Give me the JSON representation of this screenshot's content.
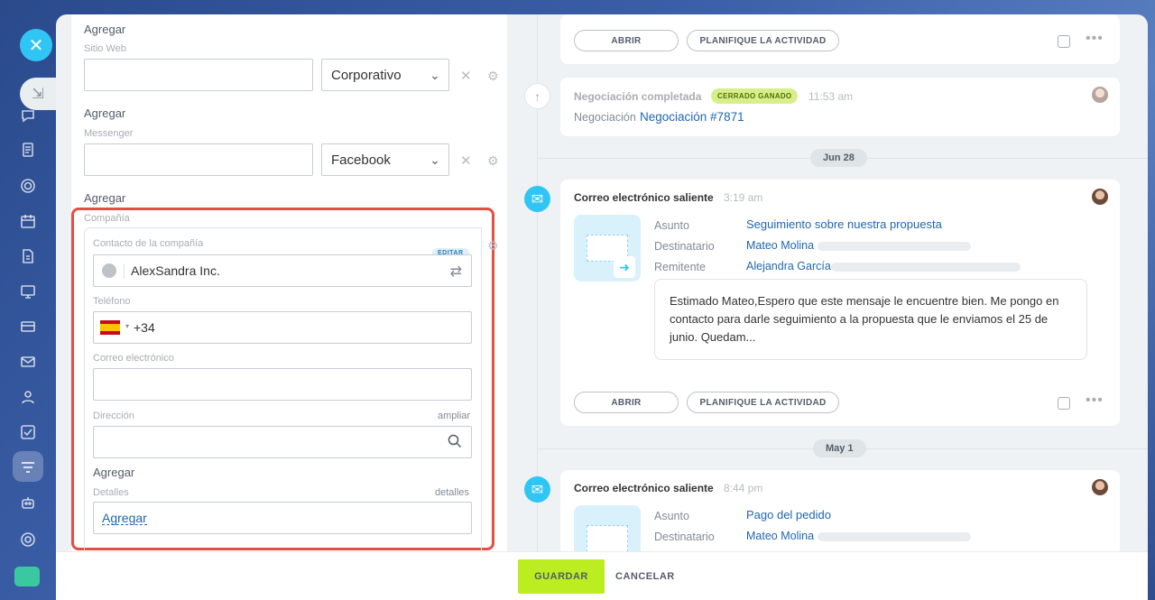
{
  "form": {
    "website": {
      "add_label": "Agregar",
      "label": "Sitio Web",
      "type_value": "Corporativo"
    },
    "messenger": {
      "add_label": "Agregar",
      "label": "Messenger",
      "type_value": "Facebook"
    },
    "add_label_3": "Agregar",
    "company": {
      "section_label": "Compañía",
      "contact_label": "Contacto de la compañía",
      "edit_badge": "EDITAR",
      "company_name": "AlexSandra Inc.",
      "phone_label": "Teléfono",
      "phone_code": "+34",
      "email_label": "Correo electrónico",
      "address_label": "Dirección",
      "address_expand": "ampliar",
      "add_label": "Agregar",
      "details_label": "Detalles",
      "details_link": "detalles",
      "details_add": "Agregar"
    }
  },
  "timeline": {
    "card1": {
      "open": "ABRIR",
      "plan": "PLANIFIQUE LA ACTIVIDAD"
    },
    "deal": {
      "title": "Negociación completada",
      "badge": "CERRADO GANADO",
      "time": "11:53 am",
      "prefix": "Negociación",
      "link": "Negociación #7871"
    },
    "date1": "Jun 28",
    "email1": {
      "title": "Correo electrónico saliente",
      "time": "3:19 am",
      "subject_label": "Asunto",
      "subject": "Seguimiento sobre nuestra propuesta",
      "to_label": "Destinatario",
      "to": "Mateo Molina",
      "from_label": "Remitente",
      "from": "Alejandra García",
      "body": "Estimado Mateo,Espero que este mensaje le encuentre bien. Me pongo en contacto para darle seguimiento a la propuesta que le enviamos el 25 de junio. Quedam...",
      "open": "ABRIR",
      "plan": "PLANIFIQUE LA ACTIVIDAD"
    },
    "date2": "May 1",
    "email2": {
      "title": "Correo electrónico saliente",
      "time": "8:44 pm",
      "subject_label": "Asunto",
      "subject": "Pago del pedido",
      "to_label": "Destinatario",
      "to": "Mateo Molina"
    }
  },
  "footer": {
    "save": "GUARDAR",
    "cancel": "CANCELAR"
  },
  "colors": {
    "accent": "#2fc6f6",
    "save": "#bbed21",
    "highlight": "#e44f45",
    "link": "#2067b0"
  }
}
